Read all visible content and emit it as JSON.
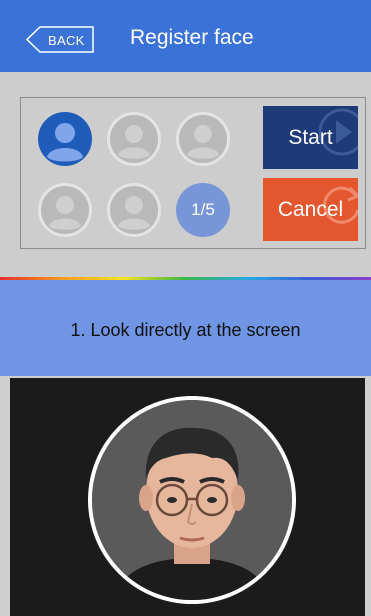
{
  "header": {
    "back_label": "BACK",
    "title": "Register face"
  },
  "slots": {
    "counter_label": "1/5",
    "captured": 1,
    "total": 5
  },
  "buttons": {
    "start_label": "Start",
    "cancel_label": "Cancel"
  },
  "instruction": {
    "text": "1. Look directly at the screen"
  },
  "colors": {
    "header": "#3b72d8",
    "start": "#1e3a78",
    "cancel": "#e4572e",
    "instruction": "#6f95e4",
    "active_slot": "#1f5bb8"
  },
  "icons": {
    "back": "chevron-left-icon",
    "slot": "person-icon",
    "start_deco": "play-icon",
    "cancel_deco": "refresh-icon"
  }
}
